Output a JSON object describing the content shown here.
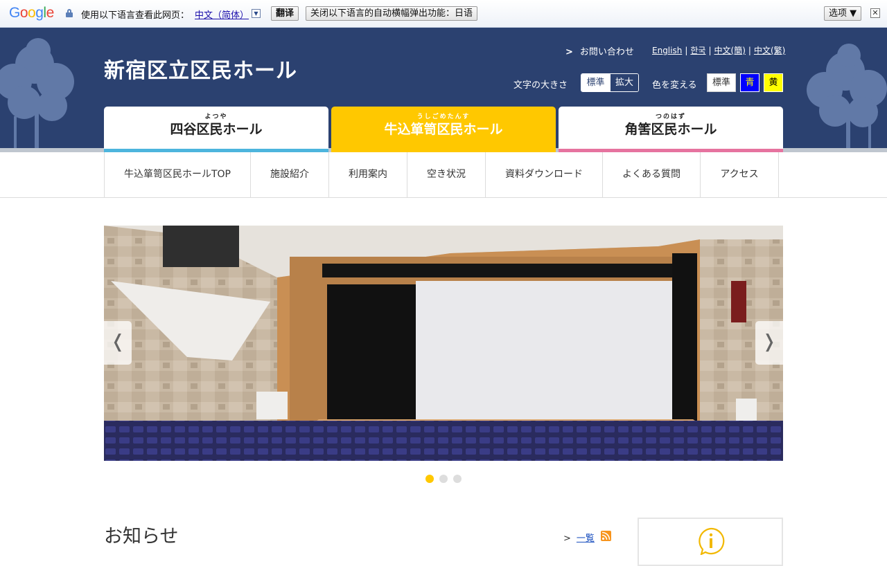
{
  "translate_bar": {
    "logo": [
      "G",
      "o",
      "o",
      "g",
      "l",
      "e"
    ],
    "prompt": "使用以下语言查看此网页：",
    "language": "中文（简体）",
    "dropdown": "▼",
    "translate_button": "翻译",
    "close_language_button": "关闭以下语言的自动横幅弹出功能：日语",
    "options_button": "选项 ▼",
    "close_symbol": "✕"
  },
  "header": {
    "site_title": "新宿区立区民ホール",
    "contact_arrow": ">",
    "contact_label": "お問い合わせ",
    "languages": [
      "English",
      "한국",
      "中文(簡)",
      "中文(繁)"
    ],
    "language_separator": "|",
    "font_size_label": "文字の大きさ",
    "font_size_standard": "標準",
    "font_size_large": "拡大",
    "color_label": "色を変える",
    "color_standard": "標準",
    "color_blue": "青",
    "color_yellow": "黄",
    "hall_tabs": [
      {
        "ruby": "よつや",
        "name": "四谷区民ホール"
      },
      {
        "ruby": "うしごめたんす",
        "name": "牛込箪笥区民ホール"
      },
      {
        "ruby": "つのはず",
        "name": "角筈区民ホール"
      }
    ]
  },
  "subnav": {
    "items": [
      "牛込箪笥区民ホールTOP",
      "施設紹介",
      "利用案内",
      "空き状況",
      "資料ダウンロード",
      "よくある質問",
      "アクセス"
    ]
  },
  "slider": {
    "prev": "❬",
    "next": "❭",
    "slide_count": 3,
    "active_slide": 1
  },
  "news": {
    "title": "お知らせ",
    "list_arrow": ">",
    "list_link": "一覧"
  },
  "colors": {
    "header_bg": "#2b4170",
    "accent_yellow": "#ffc800",
    "yotsuya_bar": "#4db5dd",
    "tsunohazu_bar": "#e6739f"
  }
}
